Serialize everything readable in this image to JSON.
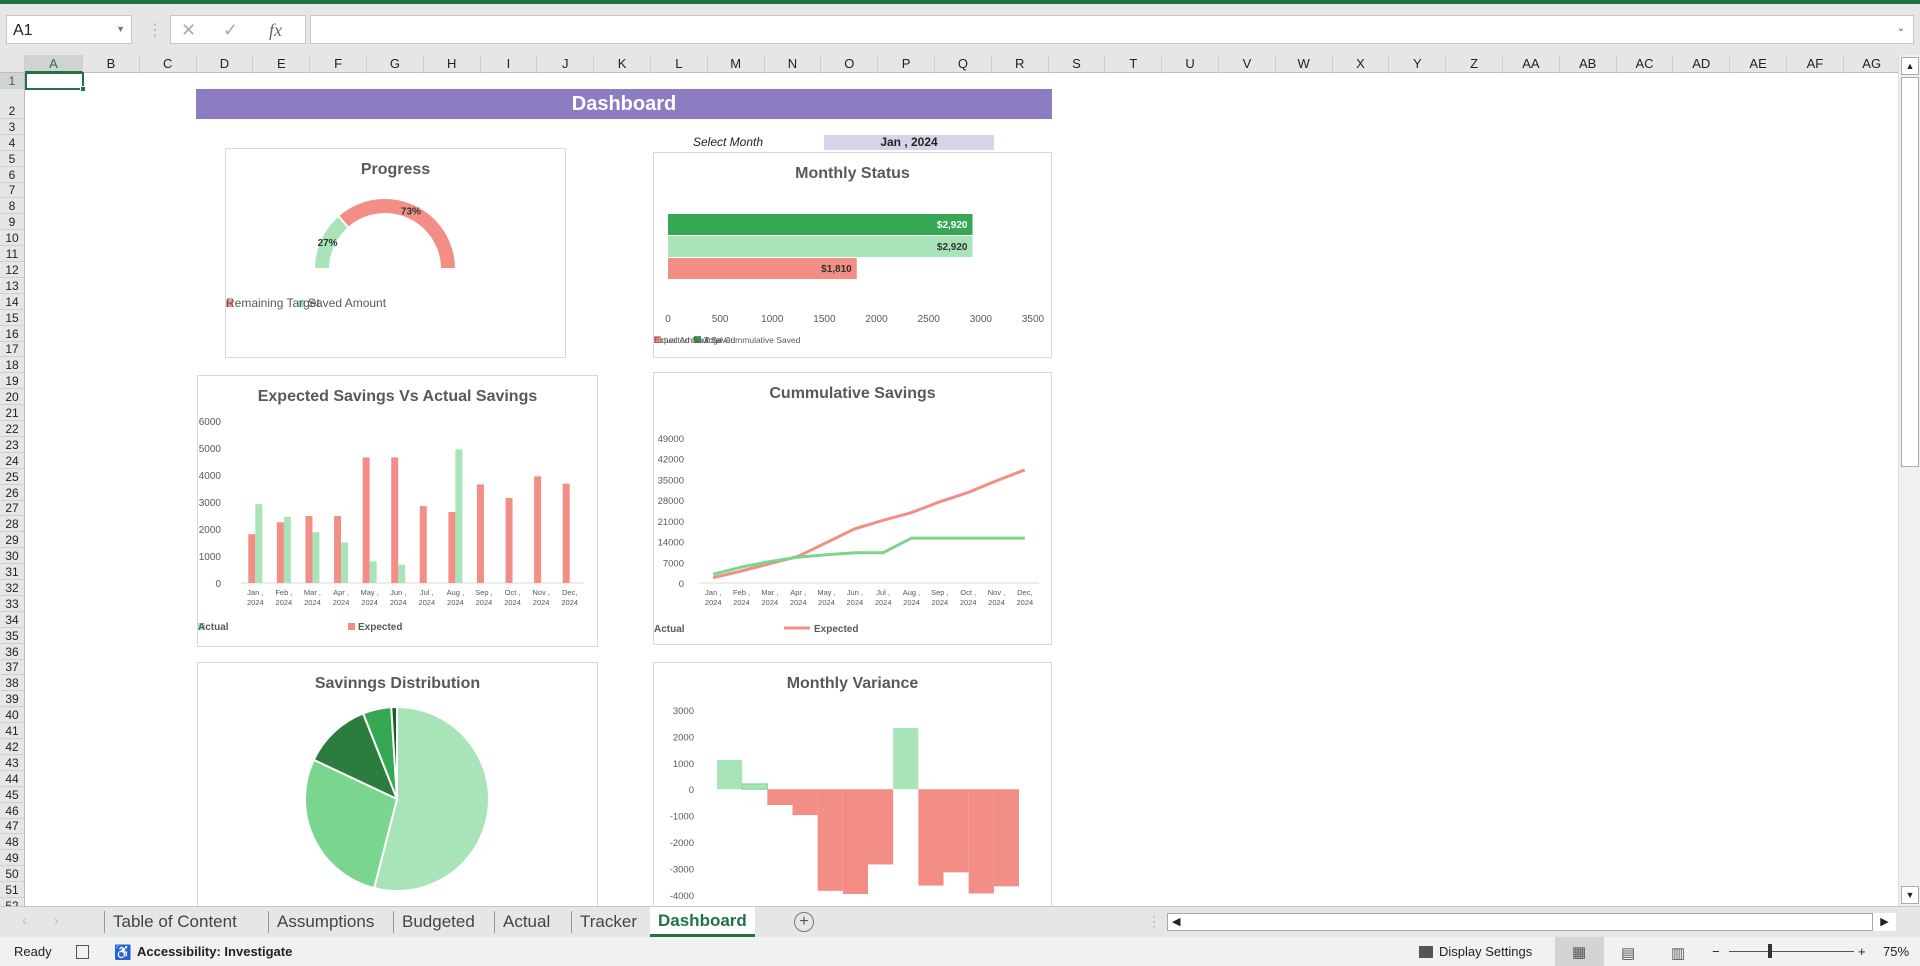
{
  "formula_bar": {
    "name_box": "A1",
    "cancel_icon": "✕",
    "enter_icon": "✓",
    "fx_label": "fx",
    "formula": ""
  },
  "columns": [
    "A",
    "B",
    "C",
    "D",
    "E",
    "F",
    "G",
    "H",
    "I",
    "J",
    "K",
    "L",
    "M",
    "N",
    "O",
    "P",
    "Q",
    "R",
    "S",
    "T",
    "U",
    "V",
    "W",
    "X",
    "Y",
    "Z",
    "AA",
    "AB",
    "AC",
    "AD",
    "AE",
    "AF",
    "AG"
  ],
  "rows": 52,
  "dashboard": {
    "title": "Dashboard",
    "select_month_label": "Select Month",
    "selected_month": "Jan , 2024"
  },
  "colors": {
    "excel_green": "#217346",
    "title_purple": "#8E7CC3",
    "month_box": "#D9D2E9",
    "expected": "#F28E86",
    "actual": "#A8E4B8",
    "dark_green": "#34A853",
    "line_actual": "#7AD58F"
  },
  "chart_data": [
    {
      "id": "progress",
      "type": "pie",
      "subtype": "half-doughnut",
      "title": "Progress",
      "series": [
        {
          "name": "Saved Amount",
          "value": 27,
          "label": "27%",
          "color": "#A8E4B8"
        },
        {
          "name": "Remaining Target",
          "value": 73,
          "label": "73%",
          "color": "#F28E86"
        }
      ],
      "legend": "bottom"
    },
    {
      "id": "monthly_status",
      "type": "bar",
      "orientation": "horizontal",
      "title": "Monthly Status",
      "series": [
        {
          "name": "Total Cummulative Saved",
          "value": 2920,
          "label": "$2,920",
          "color": "#34A853"
        },
        {
          "name": "Actual Amount Saved",
          "value": 2920,
          "label": "$2,920",
          "color": "#A8E4B8"
        },
        {
          "name": "Expected Savings",
          "value": 1810,
          "label": "$1,810",
          "color": "#F28E86"
        }
      ],
      "xlim": [
        0,
        3500
      ],
      "xticks": [
        "0",
        "500",
        "1000",
        "1500",
        "2000",
        "2500",
        "3000",
        "3500"
      ],
      "legend": "bottom"
    },
    {
      "id": "expected_vs_actual",
      "type": "bar",
      "title": "Expected Savings Vs Actual Savings",
      "categories": [
        "Jan , 2024",
        "Feb , 2024",
        "Mar , 2024",
        "Apr , 2024",
        "May , 2024",
        "Jun , 2024",
        "Jul , 2024",
        "Aug , 2024",
        "Sep , 2024",
        "Oct , 2024",
        "Nov , 2024",
        "Dec, 2024"
      ],
      "series": [
        {
          "name": "Expected",
          "color": "#F28E86",
          "values": [
            1810,
            2250,
            2480,
            2480,
            4650,
            4650,
            2850,
            2630,
            3650,
            3150,
            3950,
            3680
          ]
        },
        {
          "name": "Actual",
          "color": "#A8E4B8",
          "values": [
            2920,
            2450,
            1880,
            1500,
            800,
            680,
            0,
            4950,
            0,
            0,
            0,
            0
          ]
        }
      ],
      "ylim": [
        0,
        6000
      ],
      "yticks": [
        "0",
        "1000",
        "2000",
        "3000",
        "4000",
        "5000",
        "6000"
      ],
      "legend": "bottom"
    },
    {
      "id": "cumulative",
      "type": "line",
      "title": "Cummulative Savings",
      "categories": [
        "Jan , 2024",
        "Feb , 2024",
        "Mar , 2024",
        "Apr , 2024",
        "May , 2024",
        "Jun , 2024",
        "Jul , 2024",
        "Aug , 2024",
        "Sep , 2024",
        "Oct , 2024",
        "Nov , 2024",
        "Dec, 2024"
      ],
      "series": [
        {
          "name": "Expected",
          "color": "#F28E86",
          "values": [
            1810,
            4060,
            6540,
            9020,
            13670,
            18320,
            21170,
            23800,
            27450,
            30600,
            34550,
            38230
          ]
        },
        {
          "name": "Actual",
          "color": "#7AD58F",
          "values": [
            2920,
            5370,
            7250,
            8750,
            9550,
            10230,
            10230,
            15180,
            15180,
            15180,
            15180,
            15180
          ]
        }
      ],
      "ylim": [
        0,
        49000
      ],
      "yticks": [
        "0",
        "7000",
        "14000",
        "21000",
        "28000",
        "35000",
        "42000",
        "49000"
      ],
      "legend": "bottom"
    },
    {
      "id": "distribution",
      "type": "pie",
      "title": "Savinngs Distribution",
      "slices": [
        {
          "value": 54,
          "color": "#A8E4B8"
        },
        {
          "value": 28,
          "color": "#7AD58F"
        },
        {
          "value": 12,
          "color": "#2A7D3F"
        },
        {
          "value": 5,
          "color": "#34A853"
        },
        {
          "value": 1,
          "color": "#1E5C2E"
        }
      ]
    },
    {
      "id": "variance",
      "type": "bar",
      "subtype": "waterfall-style",
      "title": "Monthly Variance",
      "values": [
        1110,
        200,
        -600,
        -980,
        -3850,
        -3970,
        -2850,
        2320,
        -3650,
        -3150,
        -3950,
        -3680
      ],
      "positive_color": "#A8E4B8",
      "negative_color": "#F28E86",
      "ylim": [
        -4000,
        3000
      ],
      "yticks": [
        "-4000",
        "-3000",
        "-2000",
        "-1000",
        "0",
        "1000",
        "2000",
        "3000"
      ]
    }
  ],
  "sheet_tabs": [
    {
      "label": "Table of Content"
    },
    {
      "label": "Assumptions"
    },
    {
      "label": "Budgeted"
    },
    {
      "label": "Actual"
    },
    {
      "label": "Tracker"
    },
    {
      "label": "Dashboard",
      "active": true
    }
  ],
  "status_bar": {
    "ready": "Ready",
    "accessibility": "Accessibility: Investigate",
    "display_settings": "Display Settings",
    "zoom_minus": "−",
    "zoom_plus": "+",
    "zoom": "75%",
    "zoom_level": 75
  }
}
